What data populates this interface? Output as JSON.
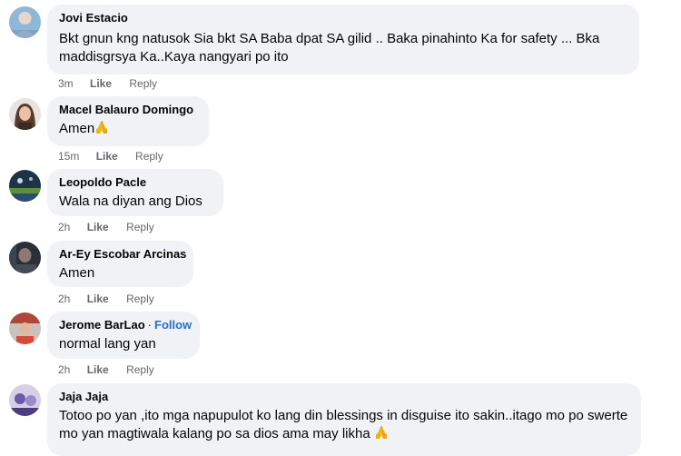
{
  "actions": {
    "like_label": "Like",
    "reply_label": "Reply"
  },
  "comments": [
    {
      "name": "Jovi Estacio",
      "text": "Bkt gnun kng natusok Sia bkt SA Baba dpat SA gilid .. Baka pinahinto Ka for safety ... Bka maddisgrsya Ka..Kaya nangyari po ito",
      "time": "3m"
    },
    {
      "name": "Macel Balauro Domingo",
      "text": "Amen",
      "emoji": "folded-hands-icon",
      "time": "15m"
    },
    {
      "name": "Leopoldo Pacle",
      "text": "Wala na diyan ang Dios",
      "time": "2h"
    },
    {
      "name": "Ar-Ey Escobar Arcinas",
      "text": "Amen",
      "time": "2h"
    },
    {
      "name": "Jerome BarLao",
      "follow_label": "Follow",
      "text": "normal lang yan",
      "time": "2h"
    },
    {
      "name": "Jaja Jaja",
      "text": "Totoo po yan ,ito mga napupulot ko lang din blessings in disguise ito sakin..itago mo po swerte mo yan magtiwala kalang po sa dios ama may likha",
      "emoji": "folded-hands-icon"
    }
  ],
  "colors": {
    "bubble": "#f0f2f5",
    "meta": "#65676b",
    "follow": "#216fdb"
  }
}
